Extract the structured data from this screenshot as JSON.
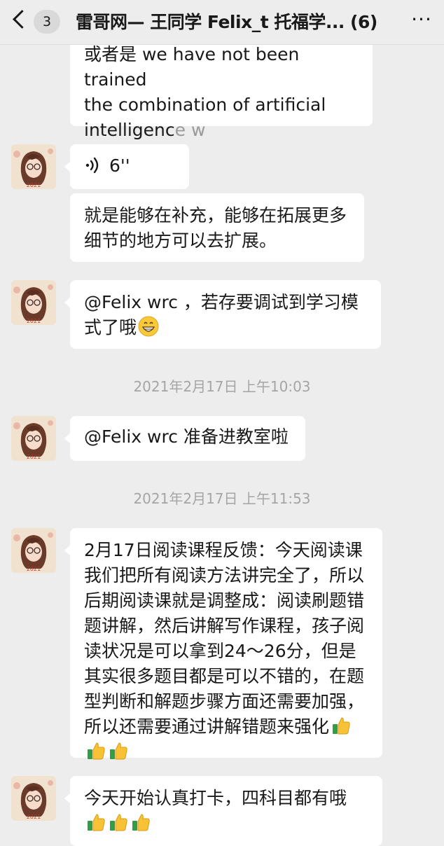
{
  "header": {
    "unread_count": "3",
    "title": "雷哥网— 王同学 Felix_t 托福学... (6)",
    "more_label": "···"
  },
  "messages": [
    {
      "type": "text",
      "lines": [
        "或者是 we have not been trained",
        "the combination of artificial"
      ],
      "last_line_main": "intelligenc",
      "last_line_faded": "e w"
    },
    {
      "type": "voice",
      "duration": "6''"
    },
    {
      "type": "text",
      "text": "就是能够在补充，能够在拓展更多细节的地方可以去扩展。"
    },
    {
      "type": "text",
      "text": "@Felix wrc ，若存要调试到学习模式了哦",
      "emoji": "grinning-face"
    },
    {
      "type": "time",
      "text": "2021年2月17日 上午10:03"
    },
    {
      "type": "text",
      "text": "@Felix wrc 准备进教室啦"
    },
    {
      "type": "time",
      "text": "2021年2月17日 上午11:53"
    },
    {
      "type": "text",
      "text": "2月17日阅读课程反馈：今天阅读课我们把所有阅读方法讲完全了，所以后期阅读课就是调整成：阅读刷题错题讲解，然后讲解写作课程，孩子阅读状况是可以拿到24～26分，但是其实很多题目都是可以不错的，在题型判断和解题步骤方面还需要加强，所以还需要通过讲解错题来强化",
      "emoji": "thumbs-up x3"
    },
    {
      "type": "text",
      "text": "今天开始认真打卡，四科目都有哦",
      "emoji": "thumbs-up x3"
    }
  ],
  "avatar": {
    "year_text": "2021"
  },
  "colors": {
    "background": "#ededed",
    "bubble": "#ffffff",
    "time": "#a5a5a5",
    "text": "#191919"
  }
}
